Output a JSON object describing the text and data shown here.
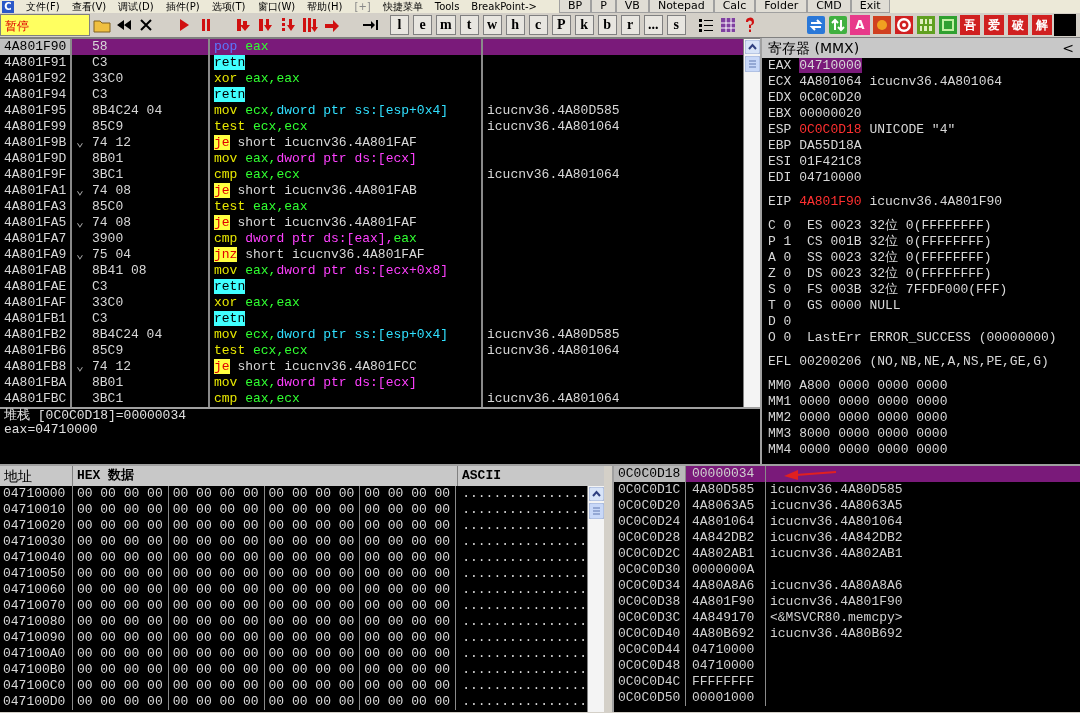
{
  "menu": {
    "logo": "C",
    "items": [
      "文件(F)",
      "查看(V)",
      "调试(D)",
      "插件(P)",
      "选项(T)",
      "窗口(W)",
      "帮助(H)"
    ],
    "extra": "[+]",
    "quick": [
      "快捷菜单",
      "Tools",
      "BreakPoint->"
    ],
    "tool_buttons": [
      "BP",
      "P",
      "VB",
      "Notepad",
      "Calc",
      "Folder",
      "CMD",
      "Exit"
    ]
  },
  "toolbar": {
    "status": "暂停",
    "letter_buttons": [
      "l",
      "e",
      "m",
      "t",
      "w",
      "h",
      "c",
      "P",
      "k",
      "b",
      "r",
      "...",
      "s"
    ],
    "font_button": "A",
    "tag_buttons": [
      "吾",
      "爱",
      "破",
      "解"
    ]
  },
  "disassembly": {
    "rows": [
      {
        "address": "4A801F90",
        "hex": "58",
        "instruction": [
          {
            "text": "pop",
            "kind": "stack"
          },
          {
            "text": " eax",
            "kind": "reg"
          }
        ],
        "selected": true
      },
      {
        "address": "4A801F91",
        "hex": "C3",
        "instruction": [
          {
            "text": "retn",
            "kind": "ret"
          }
        ],
        "selected": false
      },
      {
        "address": "4A801F92",
        "hex": "33C0",
        "instruction": [
          {
            "text": "xor",
            "kind": "op"
          },
          {
            "text": " eax,eax",
            "kind": "reg"
          }
        ],
        "selected": false
      },
      {
        "address": "4A801F94",
        "hex": "C3",
        "instruction": [
          {
            "text": "retn",
            "kind": "ret"
          }
        ],
        "selected": false
      },
      {
        "address": "4A801F95",
        "hex": "8B4C24 04",
        "instruction": [
          {
            "text": "mov",
            "kind": "op"
          },
          {
            "text": " ecx,",
            "kind": "reg"
          },
          {
            "text": "dword ptr ss:[esp+0x4]",
            "kind": "ssmem"
          }
        ],
        "comment": "icucnv36.4A80D585",
        "selected": false
      },
      {
        "address": "4A801F99",
        "hex": "85C9",
        "instruction": [
          {
            "text": "test",
            "kind": "op"
          },
          {
            "text": " ecx,ecx",
            "kind": "reg"
          }
        ],
        "comment": "icucnv36.4A801064",
        "selected": false
      },
      {
        "address": "4A801F9B",
        "jump_mark": "⌄",
        "hex": "74 12",
        "instruction": [
          {
            "text": "je",
            "kind": "jump"
          },
          {
            "text": " short icucnv36.4A801FAF"
          }
        ],
        "selected": false
      },
      {
        "address": "4A801F9D",
        "hex": "8B01",
        "instruction": [
          {
            "text": "mov",
            "kind": "op"
          },
          {
            "text": " eax,",
            "kind": "reg"
          },
          {
            "text": "dword ptr ds:[ecx]",
            "kind": "dsmem"
          }
        ],
        "selected": false
      },
      {
        "address": "4A801F9F",
        "hex": "3BC1",
        "instruction": [
          {
            "text": "cmp",
            "kind": "op"
          },
          {
            "text": " eax,ecx",
            "kind": "reg"
          }
        ],
        "comment": "icucnv36.4A801064",
        "selected": false
      },
      {
        "address": "4A801FA1",
        "jump_mark": "⌄",
        "hex": "74 08",
        "instruction": [
          {
            "text": "je",
            "kind": "jump"
          },
          {
            "text": " short icucnv36.4A801FAB"
          }
        ],
        "selected": false
      },
      {
        "address": "4A801FA3",
        "hex": "85C0",
        "instruction": [
          {
            "text": "test",
            "kind": "op"
          },
          {
            "text": " eax,eax",
            "kind": "reg"
          }
        ],
        "selected": false
      },
      {
        "address": "4A801FA5",
        "jump_mark": "⌄",
        "hex": "74 08",
        "instruction": [
          {
            "text": "je",
            "kind": "jump"
          },
          {
            "text": " short icucnv36.4A801FAF"
          }
        ],
        "selected": false
      },
      {
        "address": "4A801FA7",
        "hex": "3900",
        "instruction": [
          {
            "text": "cmp",
            "kind": "op"
          },
          {
            "text": " dword ptr ds:[eax],",
            "kind": "dsmem"
          },
          {
            "text": "eax",
            "kind": "reg"
          }
        ],
        "selected": false
      },
      {
        "address": "4A801FA9",
        "jump_mark": "⌄",
        "hex": "75 04",
        "instruction": [
          {
            "text": "jnz",
            "kind": "jump"
          },
          {
            "text": " short icucnv36.4A801FAF"
          }
        ],
        "selected": false
      },
      {
        "address": "4A801FAB",
        "hex": "8B41 08",
        "instruction": [
          {
            "text": "mov",
            "kind": "op"
          },
          {
            "text": " eax,",
            "kind": "reg"
          },
          {
            "text": "dword ptr ds:[ecx+0x8]",
            "kind": "dsmem"
          }
        ],
        "selected": false
      },
      {
        "address": "4A801FAE",
        "hex": "C3",
        "instruction": [
          {
            "text": "retn",
            "kind": "ret"
          }
        ],
        "selected": false
      },
      {
        "address": "4A801FAF",
        "hex": "33C0",
        "instruction": [
          {
            "text": "xor",
            "kind": "op"
          },
          {
            "text": " eax,eax",
            "kind": "reg"
          }
        ],
        "selected": false
      },
      {
        "address": "4A801FB1",
        "hex": "C3",
        "instruction": [
          {
            "text": "retn",
            "kind": "ret"
          }
        ],
        "selected": false
      },
      {
        "address": "4A801FB2",
        "hex": "8B4C24 04",
        "instruction": [
          {
            "text": "mov",
            "kind": "op"
          },
          {
            "text": " ecx,",
            "kind": "reg"
          },
          {
            "text": "dword ptr ss:[esp+0x4]",
            "kind": "ssmem"
          }
        ],
        "comment": "icucnv36.4A80D585",
        "selected": false
      },
      {
        "address": "4A801FB6",
        "hex": "85C9",
        "instruction": [
          {
            "text": "test",
            "kind": "op"
          },
          {
            "text": " ecx,ecx",
            "kind": "reg"
          }
        ],
        "comment": "icucnv36.4A801064",
        "selected": false
      },
      {
        "address": "4A801FB8",
        "jump_mark": "⌄",
        "hex": "74 12",
        "instruction": [
          {
            "text": "je",
            "kind": "jump"
          },
          {
            "text": " short icucnv36.4A801FCC"
          }
        ],
        "selected": false
      },
      {
        "address": "4A801FBA",
        "hex": "8B01",
        "instruction": [
          {
            "text": "mov",
            "kind": "op"
          },
          {
            "text": " eax,",
            "kind": "reg"
          },
          {
            "text": "dword ptr ds:[ecx]",
            "kind": "dsmem"
          }
        ],
        "selected": false
      },
      {
        "address": "4A801FBC",
        "hex": "3BC1",
        "instruction": [
          {
            "text": "cmp",
            "kind": "op"
          },
          {
            "text": " eax,ecx",
            "kind": "reg"
          }
        ],
        "comment": "icucnv36.4A801064",
        "selected": false
      }
    ]
  },
  "info": [
    "堆栈 [0C0C0D18]=00000034",
    "eax=04710000"
  ],
  "registers": {
    "title": "寄存器 (MMX)",
    "collapse_glyph": "<",
    "general": [
      {
        "name": "EAX",
        "value": "04710000",
        "selected": true,
        "changed": false
      },
      {
        "name": "ECX",
        "value": "4A801064",
        "comment": "icucnv36.4A801064",
        "selected": false,
        "changed": false
      },
      {
        "name": "EDX",
        "value": "0C0C0D20",
        "selected": false,
        "changed": false
      },
      {
        "name": "EBX",
        "value": "00000020",
        "selected": false,
        "changed": false
      },
      {
        "name": "ESP",
        "value": "0C0C0D18",
        "comment": "UNICODE \"4\"",
        "selected": false,
        "changed": true
      },
      {
        "name": "EBP",
        "value": "DA55D18A",
        "selected": false,
        "changed": false
      },
      {
        "name": "ESI",
        "value": "01F421C8",
        "selected": false,
        "changed": false
      },
      {
        "name": "EDI",
        "value": "04710000",
        "selected": false,
        "changed": false
      }
    ],
    "eip": {
      "name": "EIP",
      "value": "4A801F90",
      "comment": "icucnv36.4A801F90",
      "changed": true
    },
    "flags": [
      {
        "name": "C",
        "value": "0",
        "detail": "ES 0023 32位 0(FFFFFFFF)"
      },
      {
        "name": "P",
        "value": "1",
        "detail": "CS 001B 32位 0(FFFFFFFF)"
      },
      {
        "name": "A",
        "value": "0",
        "detail": "SS 0023 32位 0(FFFFFFFF)"
      },
      {
        "name": "Z",
        "value": "0",
        "detail": "DS 0023 32位 0(FFFFFFFF)"
      },
      {
        "name": "S",
        "value": "0",
        "detail": "FS 003B 32位 7FFDF000(FFF)"
      },
      {
        "name": "T",
        "value": "0",
        "detail": "GS 0000 NULL"
      },
      {
        "name": "D",
        "value": "0"
      },
      {
        "name": "O",
        "value": "0",
        "detail": "LastErr ERROR_SUCCESS (00000000)"
      }
    ],
    "efl": {
      "name": "EFL",
      "value": "00200206",
      "detail": "(NO,NB,NE,A,NS,PE,GE,G)"
    },
    "mmx": [
      {
        "name": "MM0",
        "value": "A800 0000 0000 0000"
      },
      {
        "name": "MM1",
        "value": "0000 0000 0000 0000"
      },
      {
        "name": "MM2",
        "value": "0000 0000 0000 0000"
      },
      {
        "name": "MM3",
        "value": "8000 0000 0000 0000"
      },
      {
        "name": "MM4",
        "value": "0000 0000 0000 0000"
      }
    ]
  },
  "dump": {
    "columns": [
      "地址",
      "HEX 数据",
      "ASCII"
    ],
    "rows": [
      {
        "address": "04710000",
        "hex": [
          "00 00 00 00",
          "00 00 00 00",
          "00 00 00 00",
          "00 00 00 00"
        ],
        "ascii": "................"
      },
      {
        "address": "04710010",
        "hex": [
          "00 00 00 00",
          "00 00 00 00",
          "00 00 00 00",
          "00 00 00 00"
        ],
        "ascii": "................"
      },
      {
        "address": "04710020",
        "hex": [
          "00 00 00 00",
          "00 00 00 00",
          "00 00 00 00",
          "00 00 00 00"
        ],
        "ascii": "................"
      },
      {
        "address": "04710030",
        "hex": [
          "00 00 00 00",
          "00 00 00 00",
          "00 00 00 00",
          "00 00 00 00"
        ],
        "ascii": "................"
      },
      {
        "address": "04710040",
        "hex": [
          "00 00 00 00",
          "00 00 00 00",
          "00 00 00 00",
          "00 00 00 00"
        ],
        "ascii": "................"
      },
      {
        "address": "04710050",
        "hex": [
          "00 00 00 00",
          "00 00 00 00",
          "00 00 00 00",
          "00 00 00 00"
        ],
        "ascii": "................"
      },
      {
        "address": "04710060",
        "hex": [
          "00 00 00 00",
          "00 00 00 00",
          "00 00 00 00",
          "00 00 00 00"
        ],
        "ascii": "................"
      },
      {
        "address": "04710070",
        "hex": [
          "00 00 00 00",
          "00 00 00 00",
          "00 00 00 00",
          "00 00 00 00"
        ],
        "ascii": "................"
      },
      {
        "address": "04710080",
        "hex": [
          "00 00 00 00",
          "00 00 00 00",
          "00 00 00 00",
          "00 00 00 00"
        ],
        "ascii": "................"
      },
      {
        "address": "04710090",
        "hex": [
          "00 00 00 00",
          "00 00 00 00",
          "00 00 00 00",
          "00 00 00 00"
        ],
        "ascii": "................"
      },
      {
        "address": "047100A0",
        "hex": [
          "00 00 00 00",
          "00 00 00 00",
          "00 00 00 00",
          "00 00 00 00"
        ],
        "ascii": "................"
      },
      {
        "address": "047100B0",
        "hex": [
          "00 00 00 00",
          "00 00 00 00",
          "00 00 00 00",
          "00 00 00 00"
        ],
        "ascii": "................"
      },
      {
        "address": "047100C0",
        "hex": [
          "00 00 00 00",
          "00 00 00 00",
          "00 00 00 00",
          "00 00 00 00"
        ],
        "ascii": "................"
      },
      {
        "address": "047100D0",
        "hex": [
          "00 00 00 00",
          "00 00 00 00",
          "00 00 00 00",
          "00 00 00 00"
        ],
        "ascii": "................"
      }
    ]
  },
  "stack": {
    "rows": [
      {
        "address": "0C0C0D18",
        "value": "00000034",
        "selected": true
      },
      {
        "address": "0C0C0D1C",
        "value": "4A80D585",
        "comment": "icucnv36.4A80D585",
        "selected": false
      },
      {
        "address": "0C0C0D20",
        "value": "4A8063A5",
        "comment": "icucnv36.4A8063A5",
        "selected": false
      },
      {
        "address": "0C0C0D24",
        "value": "4A801064",
        "comment": "icucnv36.4A801064",
        "selected": false
      },
      {
        "address": "0C0C0D28",
        "value": "4A842DB2",
        "comment": "icucnv36.4A842DB2",
        "selected": false
      },
      {
        "address": "0C0C0D2C",
        "value": "4A802AB1",
        "comment": "icucnv36.4A802AB1",
        "selected": false
      },
      {
        "address": "0C0C0D30",
        "value": "0000000A",
        "selected": false
      },
      {
        "address": "0C0C0D34",
        "value": "4A80A8A6",
        "comment": "icucnv36.4A80A8A6",
        "selected": false
      },
      {
        "address": "0C0C0D38",
        "value": "4A801F90",
        "comment": "icucnv36.4A801F90",
        "selected": false
      },
      {
        "address": "0C0C0D3C",
        "value": "4A849170",
        "comment": "<&MSVCR80.memcpy>",
        "selected": false
      },
      {
        "address": "0C0C0D40",
        "value": "4A80B692",
        "comment": "icucnv36.4A80B692",
        "selected": false
      },
      {
        "address": "0C0C0D44",
        "value": "04710000",
        "selected": false
      },
      {
        "address": "0C0C0D48",
        "value": "04710000",
        "selected": false
      },
      {
        "address": "0C0C0D4C",
        "value": "FFFFFFFF",
        "selected": false
      },
      {
        "address": "0C0C0D50",
        "value": "00001000",
        "selected": false
      }
    ]
  }
}
